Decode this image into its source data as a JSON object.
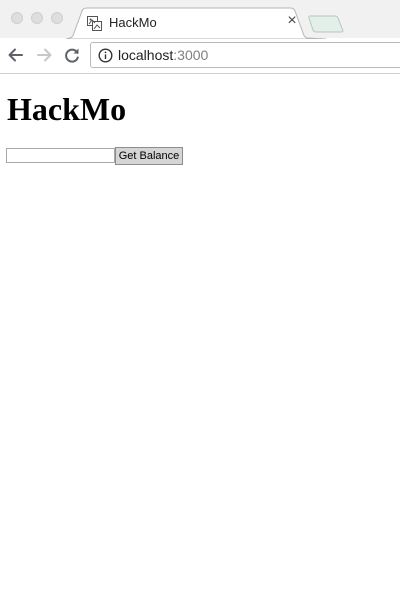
{
  "browser": {
    "tab": {
      "title": "HackMo",
      "close_label": "×",
      "favicon": "broken-image-icon"
    },
    "address_bar": {
      "host": "localhost",
      "port": ":3000",
      "security_icon": "info-icon"
    },
    "nav_icons": [
      "back-arrow-icon",
      "forward-arrow-icon",
      "reload-icon"
    ]
  },
  "page": {
    "heading": "HackMo",
    "balance_input": {
      "value": "",
      "placeholder": ""
    },
    "get_balance_button": "Get Balance"
  }
}
